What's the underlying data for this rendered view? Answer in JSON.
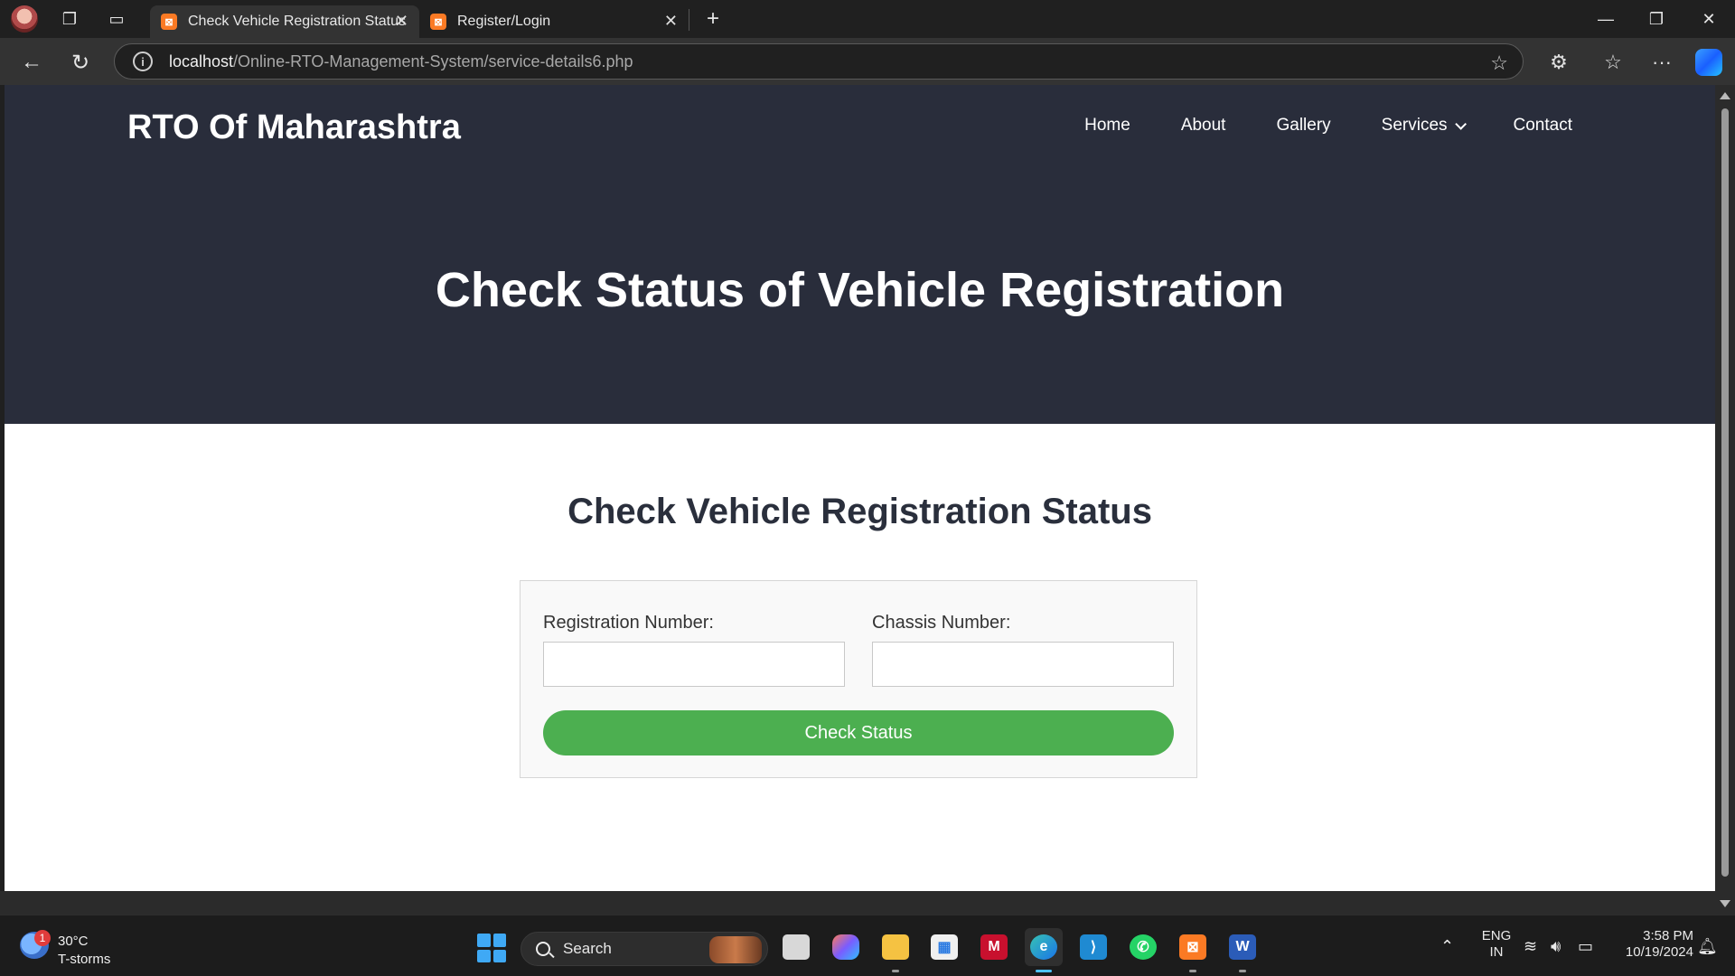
{
  "browser": {
    "tabs": [
      {
        "title": "Check Vehicle Registration Status",
        "active": true
      },
      {
        "title": "Register/Login",
        "active": false
      }
    ],
    "new_tab": "+",
    "url_host": "localhost",
    "url_path": "/Online-RTO-Management-System/service-details6.php"
  },
  "site": {
    "brand": "RTO Of Maharashtra",
    "nav": [
      "Home",
      "About",
      "Gallery",
      "Services",
      "Contact"
    ],
    "hero_title": "Check Status of Vehicle Registration",
    "section_title": "Check Vehicle Registration Status",
    "form": {
      "registration_label": "Registration Number:",
      "registration_value": "",
      "chassis_label": "Chassis Number:",
      "chassis_value": "",
      "submit_label": "Check Status"
    },
    "colors": {
      "hero_bg": "#292d3b",
      "button": "#4caf50"
    }
  },
  "taskbar": {
    "weather_badge": "1",
    "weather_temp": "30°C",
    "weather_desc": "T-storms",
    "search_label": "Search",
    "language_top": "ENG",
    "language_bottom": "IN",
    "time": "3:58 PM",
    "date": "10/19/2024"
  }
}
